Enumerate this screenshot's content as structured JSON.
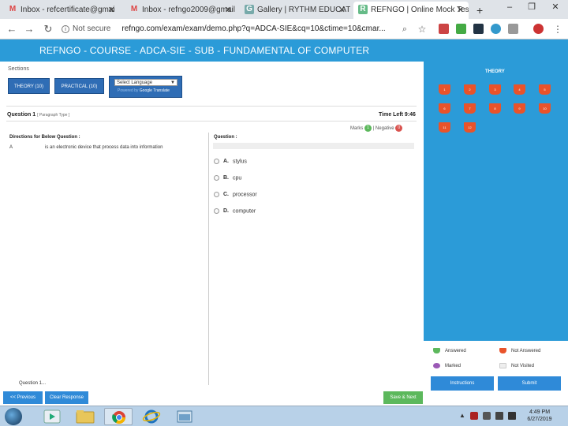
{
  "browser": {
    "tabs": [
      {
        "title": "Inbox - refcertificate@gmai",
        "icon": "gmail-icon",
        "active": false
      },
      {
        "title": "Inbox - refngo2009@gmail",
        "icon": "gmail-icon",
        "active": false
      },
      {
        "title": "Gallery | RYTHM EDUCATIO",
        "icon": "gallery-icon",
        "active": false
      },
      {
        "title": "REFNGO | Online Mock Tes",
        "icon": "refngo-icon",
        "active": true
      }
    ],
    "new_tab": "+",
    "security_label": "Not secure",
    "url": "refngo.com/exam/exam/demo.php?q=ADCA-SIE&cq=10&ctime=10&cmar..."
  },
  "site": {
    "header": "REFNGO - COURSE - ADCA-SIE - SUB - FUNDAMENTAL OF COMPUTER"
  },
  "sections": {
    "label": "Sections",
    "buttons": [
      "THEORY (10)",
      "PRACTICAL (10)"
    ],
    "language_select": "Select Language",
    "powered_by": "Powered by",
    "translate": "Translate"
  },
  "question": {
    "header": "Question 1",
    "type": "[ Paragraph Type ]",
    "time_left": "Time Left 9:46",
    "marks_label": "Marks",
    "marks_value": "1",
    "negative_label": "| Negative",
    "negative_value": "0",
    "directions_title": "Directions for Below Question :",
    "para_letter": "A",
    "para_text": "is an electronic device that process data into information",
    "question_title": "Question :",
    "options": [
      {
        "letter": "A.",
        "text": "stylus"
      },
      {
        "letter": "B.",
        "text": "cpu"
      },
      {
        "letter": "C.",
        "text": "processor"
      },
      {
        "letter": "D.",
        "text": "computer"
      }
    ],
    "next_label": "Question 1..."
  },
  "palette": {
    "title": "THEORY",
    "numbers": [
      "1",
      "2",
      "3",
      "4",
      "5",
      "6",
      "7",
      "8",
      "9",
      "10",
      "11",
      "12"
    ],
    "legend": {
      "answered": "Answered",
      "not_answered": "Not Answered",
      "marked": "Marked",
      "not_visited": "Not Visited"
    },
    "instructions": "Instructions",
    "submit": "Submit"
  },
  "actions": {
    "previous": "<< Previous",
    "clear": "Clear Response",
    "save_next": "Save & Next"
  },
  "taskbar": {
    "time": "4:49 PM",
    "date": "6/27/2019"
  },
  "colors": {
    "header_blue": "#2b9bd8",
    "button_blue": "#2f6db5",
    "not_answered": "#e9532a",
    "answered": "#5cb85c",
    "marked": "#9b59b6"
  }
}
